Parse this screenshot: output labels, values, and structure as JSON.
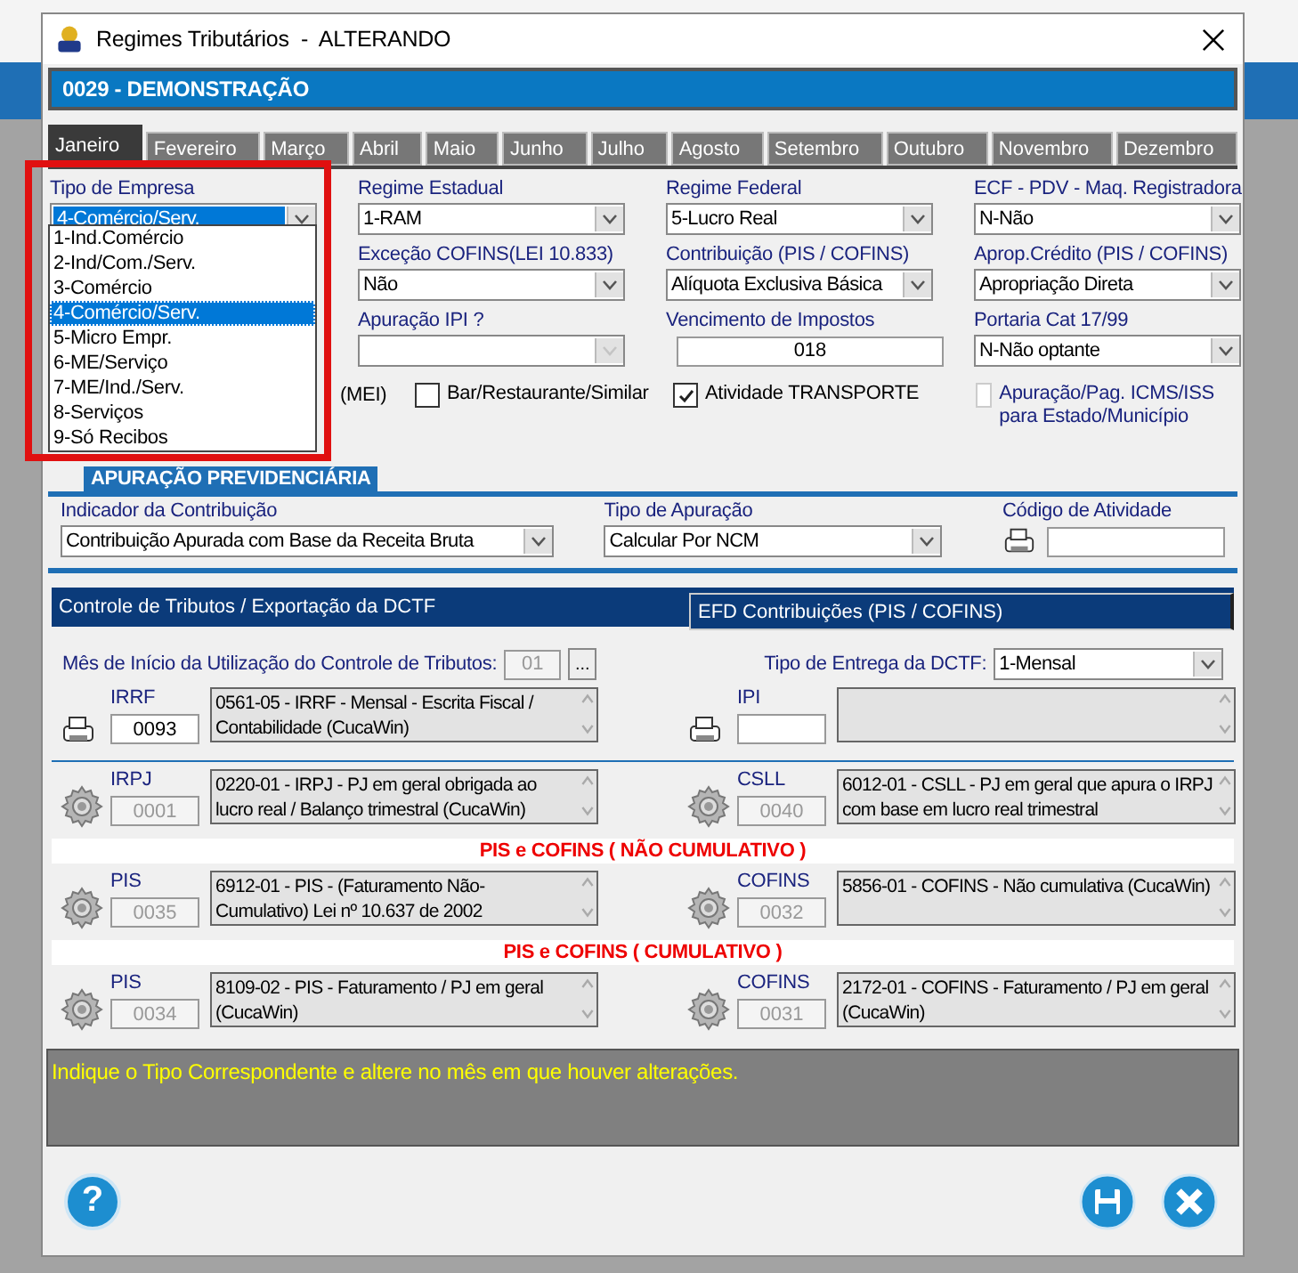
{
  "window": {
    "title": "Regimes Tributários  -  ALTERANDO"
  },
  "company": "0029 - DEMONSTRAÇÃO",
  "tabs": [
    {
      "label": "Janeiro",
      "selected": true
    },
    {
      "label": "Fevereiro",
      "selected": false
    },
    {
      "label": "Março",
      "selected": false
    },
    {
      "label": "Abril",
      "selected": false
    },
    {
      "label": "Maio",
      "selected": false
    },
    {
      "label": "Junho",
      "selected": false
    },
    {
      "label": "Julho",
      "selected": false
    },
    {
      "label": "Agosto",
      "selected": false
    },
    {
      "label": "Setembro",
      "selected": false
    },
    {
      "label": "Outubro",
      "selected": false
    },
    {
      "label": "Novembro",
      "selected": false
    },
    {
      "label": "Dezembro",
      "selected": false
    }
  ],
  "field_rows": [
    [
      {
        "kind": "select",
        "label": "Tipo de Empresa",
        "value": "4-Comércio/Serv.",
        "focused": true
      },
      {
        "kind": "select",
        "label": "Regime Estadual",
        "value": "1-RAM"
      },
      {
        "kind": "select",
        "label": "Regime Federal",
        "value": "5-Lucro Real"
      },
      {
        "kind": "select",
        "label": "ECF - PDV - Maq. Registradora",
        "value": "N-Não"
      }
    ],
    [
      {
        "kind": "select",
        "label": "Exceção COFINS(LEI 10.833)",
        "value": "Não"
      },
      {
        "kind": "select",
        "label": "Contribuição (PIS / COFINS)",
        "value": "Alíquota Exclusiva Básica"
      },
      {
        "kind": "select",
        "label": "Aprop.Crédito (PIS / COFINS)",
        "value": "Apropriação Direta"
      }
    ],
    [
      {
        "kind": "select",
        "label": "Apuração IPI ?",
        "disabled": true
      },
      {
        "kind": "lookup",
        "label": "Vencimento de Impostos",
        "value": "018"
      },
      {
        "kind": "select",
        "label": "Portaria Cat 17/99",
        "value": "N-Não optante"
      }
    ]
  ],
  "dropdown": [
    {
      "label": "1-Ind.Comércio",
      "selected": false
    },
    {
      "label": "2-Ind/Com./Serv.",
      "selected": false
    },
    {
      "label": "3-Comércio",
      "selected": false
    },
    {
      "label": "4-Comércio/Serv.",
      "selected": true
    },
    {
      "label": "5-Micro Empr.",
      "selected": false
    },
    {
      "label": "6-ME/Serviço",
      "selected": false
    },
    {
      "label": "7-ME/Ind./Serv.",
      "selected": false
    },
    {
      "label": "8-Serviços",
      "selected": false
    },
    {
      "label": "9-Só Recibos",
      "selected": false
    }
  ],
  "checkbox_text_fragment": "(MEI)",
  "checkboxes": [
    {
      "label": "Bar/Restaurante/Similar",
      "checked": false,
      "disabled": false
    },
    {
      "label": "Atividade TRANSPORTE",
      "checked": true,
      "disabled": false
    },
    {
      "label": "Apuração/Pag. ICMS/ISS para Estado/Município",
      "checked": false,
      "disabled": true
    }
  ],
  "previdenciaria": {
    "title": "APURAÇÃO PREVIDENCIÁRIA",
    "fields": [
      {
        "kind": "select",
        "label": "Indicador da Contribuição",
        "value": "Contribuição Apurada com Base da Receita Bruta"
      },
      {
        "kind": "select",
        "label": "Tipo de Apuração",
        "value": "Calcular Por NCM"
      },
      {
        "kind": "lookup",
        "label": "Código de Atividade"
      }
    ]
  },
  "subtabs": [
    {
      "label": "Controle de Tributos / Exportação da DCTF",
      "selected": true
    },
    {
      "label": "EFD Contribuições (PIS / COFINS)",
      "selected": false
    }
  ],
  "dctf": {
    "start_label": "Mês de Início da Utilização do Controle de Tributos:",
    "start_value": "01",
    "browse": "...",
    "delivery_label": "Tipo de Entrega da DCTF:",
    "delivery_value": "1-Mensal"
  },
  "tribute_sections": [
    {
      "entries": [
        {
          "kind": "lookup",
          "label": "IRRF",
          "code": "0093",
          "description": "0561-05 - IRRF - Mensal - Escrita Fiscal / Contabilidade (CucaWin)"
        },
        {
          "kind": "lookup",
          "label": "IPI"
        }
      ]
    },
    {
      "entries": [
        {
          "kind": "auto",
          "label": "IRPJ",
          "code": "0001",
          "description": "0220-01 - IRPJ - PJ em geral obrigada ao lucro real / Balanço trimestral (CucaWin)"
        },
        {
          "kind": "auto",
          "label": "CSLL",
          "code": "0040",
          "description": "6012-01 - CSLL - PJ em geral que apura o IRPJ com base em lucro real trimestral"
        }
      ]
    },
    {
      "heading": "PIS e COFINS ( NÃO CUMULATIVO )",
      "entries": [
        {
          "kind": "auto",
          "label": "PIS",
          "code": "0035",
          "description": "6912-01 - PIS - (Faturamento Não-Cumulativo) Lei nº 10.637 de 2002"
        },
        {
          "kind": "auto",
          "label": "COFINS",
          "code": "0032",
          "description": "5856-01 - COFINS - Não cumulativa (CucaWin)"
        }
      ]
    },
    {
      "heading": "PIS e COFINS ( CUMULATIVO )",
      "entries": [
        {
          "kind": "auto",
          "label": "PIS",
          "code": "0034",
          "description": "8109-02 - PIS - Faturamento / PJ em geral (CucaWin)"
        },
        {
          "kind": "auto",
          "label": "COFINS",
          "code": "0031",
          "description": "2172-01 - COFINS - Faturamento / PJ em geral (CucaWin)"
        }
      ]
    }
  ],
  "message": "Indique o Tipo Correspondente e altere no mês em que houver alterações.",
  "help": "?"
}
